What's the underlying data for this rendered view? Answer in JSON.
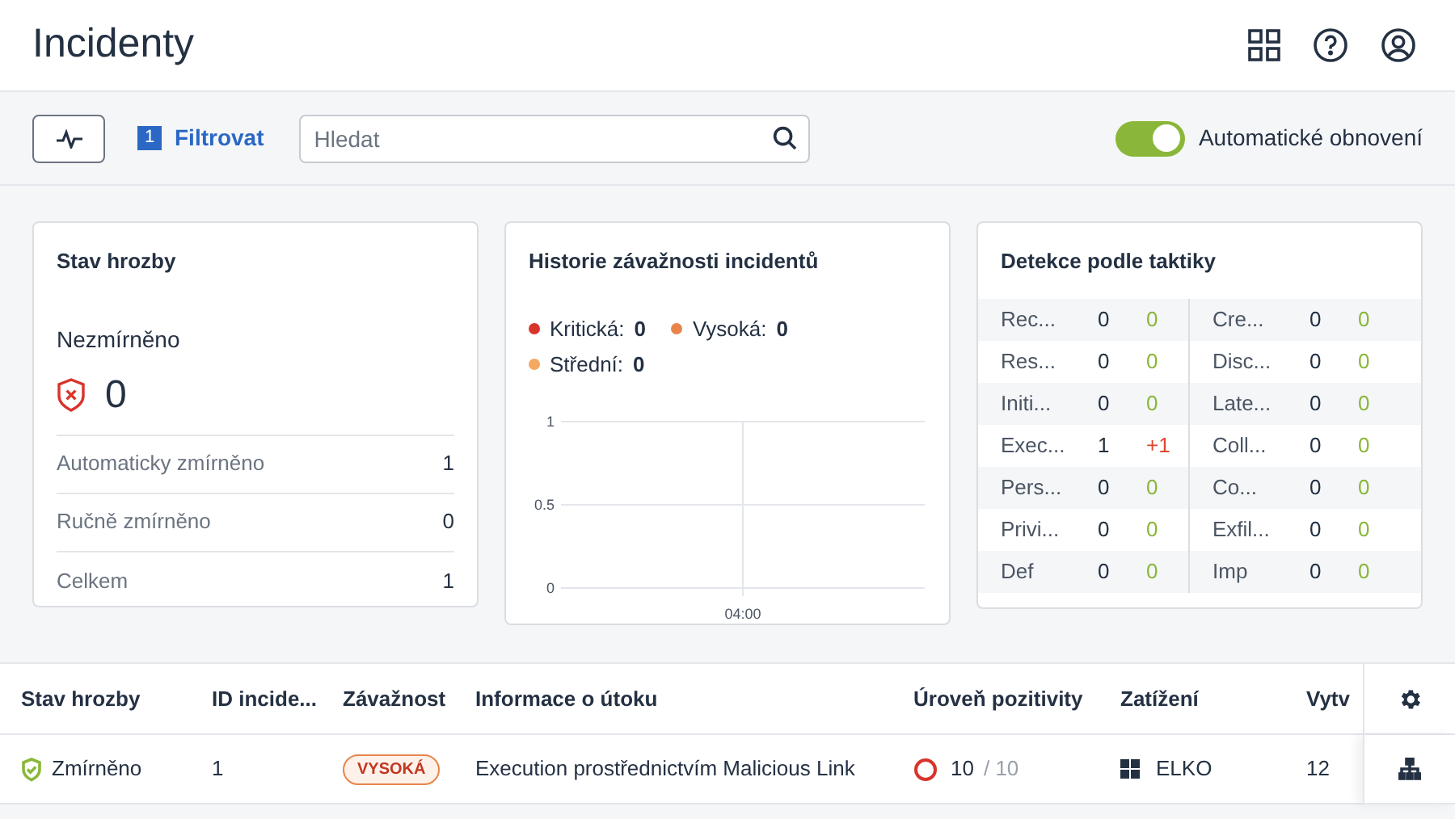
{
  "header": {
    "title": "Incidenty"
  },
  "toolbar": {
    "filter_count": "1",
    "filter_label": "Filtrovat",
    "search": {
      "placeholder": "Hledat"
    },
    "auto_refresh": {
      "label": "Automatické obnovení",
      "on": true
    }
  },
  "threat_status": {
    "title": "Stav hrozby",
    "unmitigated_label": "Nezmírněno",
    "unmitigated_value": "0",
    "rows": [
      {
        "label": "Automaticky zmírněno",
        "value": "1"
      },
      {
        "label": "Ručně zmírněno",
        "value": "0"
      },
      {
        "label": "Celkem",
        "value": "1"
      }
    ]
  },
  "severity_history": {
    "title": "Historie závažnosti incidentů",
    "legend": [
      {
        "label": "Kritická:",
        "value": "0",
        "color": "#d9342b"
      },
      {
        "label": "Vysoká:",
        "value": "0",
        "color": "#e8844a"
      },
      {
        "label": "Střední:",
        "value": "0",
        "color": "#f4a860"
      }
    ],
    "chart_data": {
      "type": "line",
      "categories": [
        "04:00"
      ],
      "ylim": [
        0,
        1
      ],
      "yticks": [
        0,
        0.5,
        1
      ]
    }
  },
  "tactics": {
    "title": "Detekce podle taktiky",
    "rows": [
      [
        {
          "name": "Rec...",
          "count": "0",
          "delta": "0",
          "color": "#8ab73a"
        },
        {
          "name": "Cre...",
          "count": "0",
          "delta": "0",
          "color": "#8ab73a"
        }
      ],
      [
        {
          "name": "Res...",
          "count": "0",
          "delta": "0",
          "color": "#8ab73a"
        },
        {
          "name": "Disc...",
          "count": "0",
          "delta": "0",
          "color": "#8ab73a"
        }
      ],
      [
        {
          "name": "Initi...",
          "count": "0",
          "delta": "0",
          "color": "#8ab73a"
        },
        {
          "name": "Late...",
          "count": "0",
          "delta": "0",
          "color": "#8ab73a"
        }
      ],
      [
        {
          "name": "Exec...",
          "count": "1",
          "delta": "+1",
          "color": "#e0452f"
        },
        {
          "name": "Coll...",
          "count": "0",
          "delta": "0",
          "color": "#8ab73a"
        }
      ],
      [
        {
          "name": "Pers...",
          "count": "0",
          "delta": "0",
          "color": "#8ab73a"
        },
        {
          "name": "Co...",
          "count": "0",
          "delta": "0",
          "color": "#8ab73a"
        }
      ],
      [
        {
          "name": "Privi...",
          "count": "0",
          "delta": "0",
          "color": "#8ab73a"
        },
        {
          "name": "Exfil...",
          "count": "0",
          "delta": "0",
          "color": "#8ab73a"
        }
      ],
      [
        {
          "name": "Def",
          "count": "0",
          "delta": "0",
          "color": "#8ab73a"
        },
        {
          "name": "Imp",
          "count": "0",
          "delta": "0",
          "color": "#8ab73a"
        }
      ]
    ]
  },
  "table": {
    "columns": [
      "Stav hrozby",
      "ID incide...",
      "Závažnost",
      "Informace o útoku",
      "Úroveň pozitivity",
      "Zatížení",
      "Vytv"
    ],
    "rows": [
      {
        "status": "Zmírněno",
        "incident_number": "1",
        "severity": "VYSOKÁ",
        "attack": "Execution prostřednictvím Malicious Link",
        "positivity": "10",
        "positivity_max": "/ 10",
        "workload": "ELKO",
        "created": "12"
      }
    ]
  }
}
